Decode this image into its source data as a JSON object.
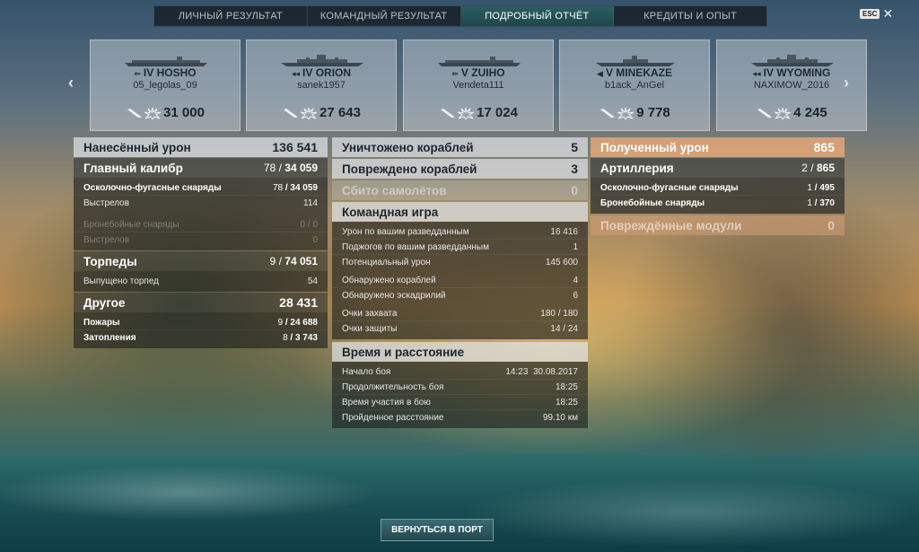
{
  "tabs": [
    "Личный результат",
    "Командный результат",
    "Подробный отчёт",
    "Кредиты и опыт"
  ],
  "active_tab": 2,
  "esc_label": "ESC",
  "close_glyph": "✕",
  "nav": {
    "prev_glyph": "‹",
    "next_glyph": "›"
  },
  "ships": [
    {
      "tier": "IV",
      "name": "HOSHO",
      "class_icon": "aircraft-carrier-icon",
      "player": "05_legolas_09",
      "damage": "31 000"
    },
    {
      "tier": "IV",
      "name": "ORION",
      "class_icon": "battleship-icon",
      "player": "sanek1957",
      "damage": "27 643"
    },
    {
      "tier": "V",
      "name": "ZUIHO",
      "class_icon": "aircraft-carrier-icon",
      "player": "Vendeta111",
      "damage": "17 024"
    },
    {
      "tier": "V",
      "name": "MINEKAZE",
      "class_icon": "destroyer-icon",
      "player": "b1ack_AnGel",
      "damage": "9 778"
    },
    {
      "tier": "IV",
      "name": "WYOMING",
      "class_icon": "battleship-icon",
      "player": "NAXIMOW_2016",
      "damage": "4 245"
    }
  ],
  "dealt": {
    "head": {
      "label": "Нанесённый урон",
      "value": "136 541"
    },
    "main_battery": {
      "label": "Главный калибр",
      "a": "78",
      "b": "34 059"
    },
    "he_label": "Осколочно-фугасные снаряды",
    "he_a": "78",
    "he_b": "34 059",
    "he_shots_label": "Выстрелов",
    "he_shots": "114",
    "ap_label": "Бронебойные снаряды",
    "ap_a": "0",
    "ap_b": "0",
    "ap_shots_label": "Выстрелов",
    "ap_shots": "0",
    "torpedoes": {
      "label": "Торпеды",
      "a": "9",
      "b": "74 051"
    },
    "torps_fired_label": "Выпущено торпед",
    "torps_fired": "54",
    "other": {
      "label": "Другое",
      "value": "28 431"
    },
    "fires_label": "Пожары",
    "fires_a": "9",
    "fires_b": "24 688",
    "flood_label": "Затопления",
    "flood_a": "8",
    "flood_b": "3 743"
  },
  "middle": {
    "destroyed": {
      "label": "Уничтожено кораблей",
      "value": "5"
    },
    "damaged": {
      "label": "Повреждено кораблей",
      "value": "3"
    },
    "planes": {
      "label": "Сбито самолётов",
      "value": "0"
    },
    "team": {
      "label": "Командная игра",
      "rows": [
        {
          "label": "Урон по вашим разведданным",
          "value": "16 416"
        },
        {
          "label": "Поджогов по вашим разведданным",
          "value": "1"
        },
        {
          "label": "Потенциальный урон",
          "value": "145 600"
        },
        {
          "label": "Обнаружено кораблей",
          "value": "4"
        },
        {
          "label": "Обнаружено эскадрилий",
          "value": "6"
        },
        {
          "label": "Очки захвата",
          "value": "180 / 180"
        },
        {
          "label": "Очки защиты",
          "value": "14 / 24"
        }
      ]
    },
    "time": {
      "label": "Время и расстояние",
      "rows": [
        {
          "label": "Начало боя",
          "value": "14:23  30.08.2017"
        },
        {
          "label": "Продолжительность боя",
          "value": "18:25"
        },
        {
          "label": "Время участия в бою",
          "value": "18:25"
        },
        {
          "label": "Пройденное расстояние",
          "value": "99.10 км"
        }
      ]
    }
  },
  "received": {
    "head": {
      "label": "Полученный урон",
      "value": "865"
    },
    "artillery": {
      "label": "Артиллерия",
      "a": "2",
      "b": "865"
    },
    "he_label": "Осколочно-фугасные снаряды",
    "he_a": "1",
    "he_b": "495",
    "ap_label": "Бронебойные снаряды",
    "ap_a": "1",
    "ap_b": "370",
    "modules": {
      "label": "Повреждённые модули",
      "value": "0"
    }
  },
  "return_button": "Вернуться в порт",
  "colors": {
    "active_tab": "#2b5e62",
    "received_header": "#ecaa78"
  }
}
